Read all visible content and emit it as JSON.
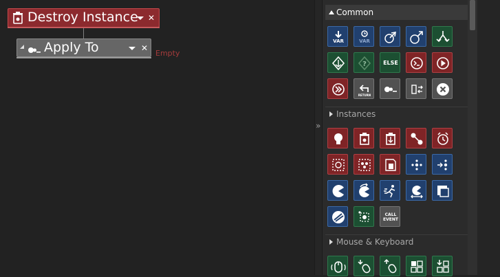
{
  "editor": {
    "destroy_label": "Destroy Instance",
    "apply_label": "Apply To",
    "apply_value": "Empty"
  },
  "palette": {
    "sections": [
      {
        "label": "Common",
        "expanded": true
      },
      {
        "label": "Instances",
        "expanded": true
      },
      {
        "label": "Mouse & Keyboard",
        "expanded": true
      }
    ],
    "common_tiles": [
      {
        "icon": "declare-var-icon",
        "color": "blue",
        "text": "VAR"
      },
      {
        "icon": "get-var-icon",
        "color": "blue",
        "text": "VAR"
      },
      {
        "icon": "global-in-icon",
        "color": "blue"
      },
      {
        "icon": "global-out-icon",
        "color": "blue"
      },
      {
        "icon": "branch-icon",
        "color": "green"
      },
      {
        "icon": "if-variable-icon",
        "color": "green"
      },
      {
        "icon": "if-expression-icon",
        "color": "green"
      },
      {
        "icon": "else-icon",
        "color": "green",
        "text": "ELSE"
      },
      {
        "icon": "execute-code-icon",
        "color": "red"
      },
      {
        "icon": "play-icon",
        "color": "red"
      },
      {
        "icon": "fast-forward-icon",
        "color": "red"
      },
      {
        "icon": "return-icon",
        "color": "gray",
        "text": "RETURN"
      },
      {
        "icon": "apply-to-icon",
        "color": "gray"
      },
      {
        "icon": "swap-icon",
        "color": "gray"
      },
      {
        "icon": "exit-icon",
        "color": "gray"
      }
    ],
    "instances_tiles": [
      {
        "icon": "create-instance-icon",
        "color": "red"
      },
      {
        "icon": "destroy-instance-icon",
        "color": "red"
      },
      {
        "icon": "change-instance-icon",
        "color": "red"
      },
      {
        "icon": "instance-moving-icon",
        "color": "red"
      },
      {
        "icon": "alarm-icon",
        "color": "red"
      },
      {
        "icon": "region-select-icon",
        "color": "red"
      },
      {
        "icon": "instance-count-icon",
        "color": "red"
      },
      {
        "icon": "instance-exists-icon",
        "color": "red"
      },
      {
        "icon": "instances-dots-icon",
        "color": "blue"
      },
      {
        "icon": "instance-nearest-icon",
        "color": "blue"
      },
      {
        "icon": "pacman-icon",
        "color": "blue"
      },
      {
        "icon": "rotate-icon",
        "color": "blue"
      },
      {
        "icon": "run-icon",
        "color": "blue"
      },
      {
        "icon": "bounce-icon",
        "color": "blue"
      },
      {
        "icon": "depth-icon",
        "color": "blue"
      },
      {
        "icon": "mask-icon",
        "color": "blue"
      },
      {
        "icon": "collision-icon",
        "color": "green"
      },
      {
        "icon": "call-event-icon",
        "color": "gray",
        "text": "CALL EVENT"
      }
    ],
    "mouse_tiles": [
      {
        "icon": "mouse-event-icon",
        "color": "green"
      },
      {
        "icon": "mouse-down-icon",
        "color": "green"
      },
      {
        "icon": "mouse-up-icon",
        "color": "green"
      },
      {
        "icon": "grid-icon",
        "color": "green"
      },
      {
        "icon": "grid-down-icon",
        "color": "green"
      }
    ]
  },
  "colors": {
    "red_action": "#8c2a2e",
    "gray_action": "#666666",
    "blue_tile": "#21406e",
    "green_tile": "#1c4f32",
    "red_tile": "#7f2426",
    "gray_tile": "#515151",
    "empty_text": "#a33b3b"
  }
}
